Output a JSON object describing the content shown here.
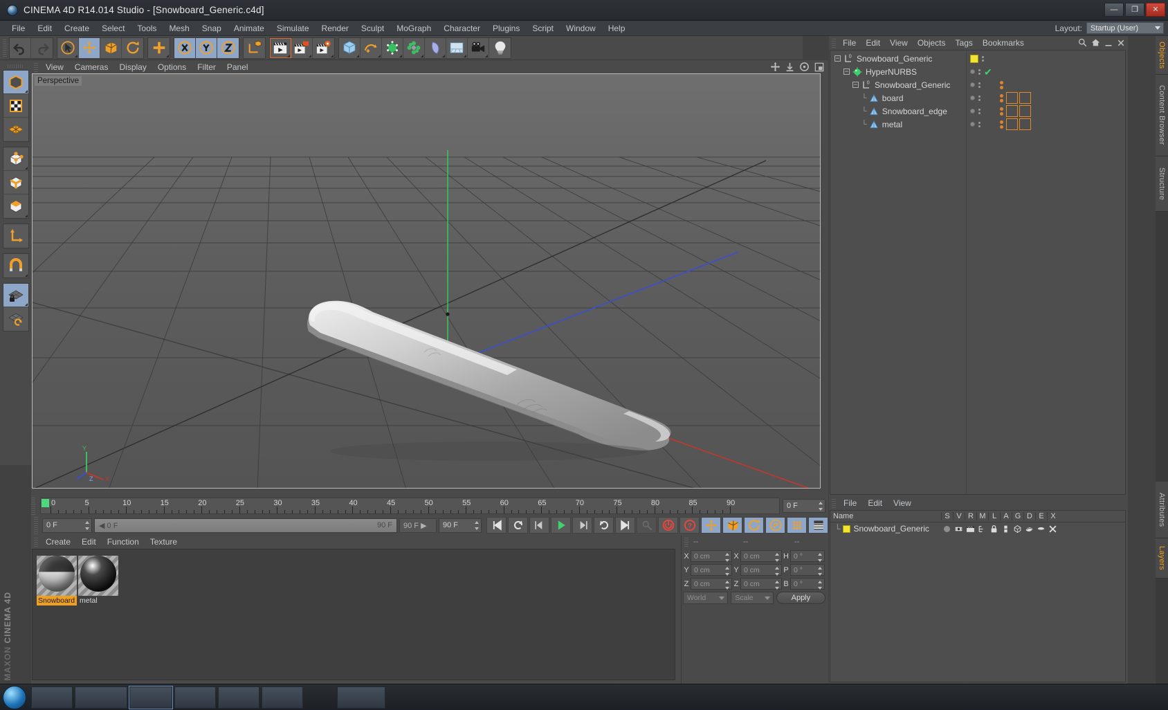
{
  "window": {
    "title": "CINEMA 4D R14.014 Studio - [Snowboard_Generic.c4d]",
    "logo_icon": "cinema4d-logo-icon",
    "buttons": {
      "minimize": "—",
      "maximize": "❐",
      "close": "✕"
    }
  },
  "menubar": {
    "items": [
      "File",
      "Edit",
      "Create",
      "Select",
      "Tools",
      "Mesh",
      "Snap",
      "Animate",
      "Simulate",
      "Render",
      "Sculpt",
      "MoGraph",
      "Character",
      "Plugins",
      "Script",
      "Window",
      "Help"
    ],
    "layout_label": "Layout:",
    "layout_value": "Startup (User)"
  },
  "toolbar": {
    "groups": [
      {
        "name": "history",
        "buttons": [
          {
            "name": "undo-button",
            "icon": "undo-icon",
            "state": "normal"
          },
          {
            "name": "redo-button",
            "icon": "redo-icon",
            "state": "disabled"
          }
        ]
      },
      {
        "name": "transform",
        "buttons": [
          {
            "name": "live-selection-tool",
            "icon": "cursor-circle-icon",
            "state": "normal"
          },
          {
            "name": "move-tool",
            "icon": "move-arrows-icon",
            "state": "active"
          },
          {
            "name": "scale-tool",
            "icon": "scale-box-icon",
            "state": "normal"
          },
          {
            "name": "rotate-tool",
            "icon": "rotate-arc-icon",
            "state": "normal"
          }
        ]
      },
      {
        "name": "place",
        "buttons": [
          {
            "name": "place-tool",
            "icon": "plus-cross-icon",
            "state": "normal"
          }
        ]
      },
      {
        "name": "axis-locks",
        "buttons": [
          {
            "name": "lock-x-axis",
            "icon": "x-axis-icon",
            "state": "active"
          },
          {
            "name": "lock-y-axis",
            "icon": "y-axis-icon",
            "state": "active"
          },
          {
            "name": "lock-z-axis",
            "icon": "z-axis-icon",
            "state": "active"
          }
        ]
      },
      {
        "name": "coord-system",
        "buttons": [
          {
            "name": "world-object-coordinates",
            "icon": "axis-cube-icon",
            "state": "normal"
          }
        ]
      },
      {
        "name": "render",
        "buttons": [
          {
            "name": "render-view-button",
            "icon": "clapperboard-icon",
            "state": "selected"
          },
          {
            "name": "render-region-button",
            "icon": "clapperboard-region-icon",
            "state": "normal"
          },
          {
            "name": "render-settings-button",
            "icon": "clapperboard-gear-icon",
            "state": "normal"
          }
        ]
      },
      {
        "name": "objects",
        "buttons": [
          {
            "name": "add-cube-object",
            "icon": "cube-icon",
            "state": "normal"
          },
          {
            "name": "add-spline",
            "icon": "spline-pen-icon",
            "state": "normal"
          },
          {
            "name": "add-nurbs-generator",
            "icon": "green-cube-icon",
            "state": "normal"
          },
          {
            "name": "add-array-object",
            "icon": "array-clover-icon",
            "state": "normal"
          },
          {
            "name": "add-deformer",
            "icon": "bend-deformer-icon",
            "state": "normal"
          },
          {
            "name": "add-environment",
            "icon": "floor-env-icon",
            "state": "normal"
          },
          {
            "name": "add-camera",
            "icon": "camera-icon",
            "state": "normal"
          },
          {
            "name": "add-light",
            "icon": "light-bulb-icon",
            "state": "normal"
          }
        ]
      }
    ]
  },
  "lefttoolbar": {
    "groups": [
      [
        {
          "name": "model-mode",
          "icon": "model-cube-icon",
          "state": "active"
        },
        {
          "name": "texture-mode",
          "icon": "texture-checker-icon",
          "state": "normal"
        },
        {
          "name": "deformation-mode",
          "icon": "deform-grid-icon",
          "state": "normal"
        }
      ],
      [
        {
          "name": "points-mode",
          "icon": "points-cube-icon",
          "state": "normal"
        },
        {
          "name": "edges-mode",
          "icon": "edges-cube-icon",
          "state": "normal"
        },
        {
          "name": "polygons-mode",
          "icon": "polygons-cube-icon",
          "state": "normal"
        }
      ],
      [
        {
          "name": "object-axis-mode",
          "icon": "axis-l-icon",
          "state": "normal"
        }
      ],
      [
        {
          "name": "enable-snapping",
          "icon": "magnet-icon",
          "state": "normal"
        }
      ],
      [
        {
          "name": "workplane-lock",
          "icon": "workplane-lock-icon",
          "state": "active"
        },
        {
          "name": "workplane-rotate",
          "icon": "workplane-rotate-icon",
          "state": "normal"
        }
      ]
    ]
  },
  "viewport": {
    "menu": [
      "View",
      "Cameras",
      "Display",
      "Options",
      "Filter",
      "Panel"
    ],
    "label": "Perspective",
    "nav_icons": [
      "pan-icon",
      "dolly-icon",
      "orbit-icon",
      "maximize-view-icon"
    ],
    "axes": {
      "x": "X",
      "y": "Y",
      "z": "Z"
    },
    "object": "snowboard-mesh"
  },
  "timeline": {
    "tick_labels": [
      "0",
      "5",
      "10",
      "15",
      "20",
      "25",
      "30",
      "35",
      "40",
      "45",
      "50",
      "55",
      "60",
      "65",
      "70",
      "75",
      "80",
      "85",
      "90"
    ],
    "min_frame": 0,
    "max_frame": 90,
    "current_frame_field": "0 F"
  },
  "playbar": {
    "start_field": "0 F",
    "scrub_left": "0 F",
    "scrub_right": "90 F",
    "end_preview": "90 F ▶",
    "end_field": "90 F",
    "buttons": [
      {
        "name": "go-to-start-button",
        "icon": "skip-start-icon",
        "state": "normal"
      },
      {
        "name": "play-backwards-loop-button",
        "icon": "loop-back-icon",
        "state": "normal"
      },
      {
        "name": "previous-frame-button",
        "icon": "step-back-icon",
        "state": "normal"
      },
      {
        "name": "play-button",
        "icon": "play-icon",
        "state": "normal"
      },
      {
        "name": "next-frame-button",
        "icon": "step-forward-icon",
        "state": "normal"
      },
      {
        "name": "play-forward-loop-button",
        "icon": "loop-forward-icon",
        "state": "normal"
      },
      {
        "name": "go-to-end-button",
        "icon": "skip-end-icon",
        "state": "normal"
      },
      {
        "name": "record-active-objects-button",
        "icon": "key-disabled-icon",
        "state": "disabled"
      },
      {
        "name": "autokeying-button",
        "icon": "autokey-icon",
        "state": "normal"
      },
      {
        "name": "keyframe-selection-button",
        "icon": "question-icon",
        "state": "normal"
      },
      {
        "name": "record-position-button",
        "icon": "position-move-icon",
        "state": "active"
      },
      {
        "name": "record-scale-button",
        "icon": "scale-icon",
        "state": "active"
      },
      {
        "name": "record-rotation-button",
        "icon": "rotation-icon",
        "state": "active"
      },
      {
        "name": "record-pla-button",
        "icon": "pla-icon",
        "state": "active"
      },
      {
        "name": "record-parameter-button",
        "icon": "param-dots-icon",
        "state": "active"
      },
      {
        "name": "level-of-detail-button",
        "icon": "lod-icon",
        "state": "active"
      }
    ]
  },
  "material_manager": {
    "menu": [
      "Create",
      "Edit",
      "Function",
      "Texture"
    ],
    "materials": [
      {
        "name": "Snowboard",
        "selected": true,
        "preview": "glossy-light-sphere"
      },
      {
        "name": "metal",
        "selected": false,
        "preview": "glossy-dark-sphere"
      }
    ]
  },
  "coordinates": {
    "headers": [
      "--",
      "--",
      "--"
    ],
    "rows": [
      {
        "l1": "X",
        "v1": "0 cm",
        "l2": "X",
        "v2": "0 cm",
        "l3": "H",
        "v3": "0 °"
      },
      {
        "l1": "Y",
        "v1": "0 cm",
        "l2": "Y",
        "v2": "0 cm",
        "l3": "P",
        "v3": "0 °"
      },
      {
        "l1": "Z",
        "v1": "0 cm",
        "l2": "Z",
        "v2": "0 cm",
        "l3": "B",
        "v3": "0 °"
      }
    ],
    "system_select": "World",
    "mode_select": "Scale",
    "apply_label": "Apply"
  },
  "object_manager": {
    "menu": [
      "File",
      "Edit",
      "View",
      "Objects",
      "Tags",
      "Bookmarks"
    ],
    "tools": [
      "search-icon",
      "home-icon",
      "minimize-icon",
      "close-icon"
    ],
    "items": [
      {
        "name": "Snowboard_Generic",
        "depth": 0,
        "icon": "null-object-icon",
        "expanded": true,
        "layer_color": "#f2e531",
        "tags": [],
        "check": false
      },
      {
        "name": "HyperNURBS",
        "depth": 1,
        "icon": "hypernurbs-icon",
        "expanded": true,
        "layer_color": "",
        "tags": [],
        "check": true
      },
      {
        "name": "Snowboard_Generic",
        "depth": 2,
        "icon": "null-object-icon",
        "expanded": true,
        "layer_color": "",
        "tags": [
          "dot"
        ],
        "check": false
      },
      {
        "name": "board",
        "depth": 3,
        "icon": "polygon-object-icon",
        "expanded": false,
        "layer_color": "",
        "tags": [
          "dot",
          "material-light",
          "checker"
        ],
        "check": false
      },
      {
        "name": "Snowboard_edge",
        "depth": 3,
        "icon": "polygon-object-icon",
        "expanded": false,
        "layer_color": "",
        "tags": [
          "dot",
          "material-light",
          "checker"
        ],
        "check": false
      },
      {
        "name": "metal",
        "depth": 3,
        "icon": "polygon-object-icon",
        "expanded": false,
        "layer_color": "",
        "tags": [
          "dot",
          "material-dark",
          "checker"
        ],
        "check": false
      }
    ]
  },
  "layer_manager": {
    "menu": [
      "File",
      "Edit",
      "View"
    ],
    "columns": [
      "Name",
      "S",
      "V",
      "R",
      "M",
      "L",
      "A",
      "G",
      "D",
      "E",
      "X"
    ],
    "rows": [
      {
        "name": "Snowboard_Generic",
        "color": "#f2e531",
        "cells": [
          "solo-dot",
          "view-icon",
          "render-icon",
          "manager-icon",
          "lock-icon",
          "animation-icon",
          "generator-icon",
          "deformer-icon",
          "expression-icon",
          "xref-icon"
        ]
      }
    ]
  },
  "side_tabs_top": [
    {
      "label": "Objects",
      "active": true
    },
    {
      "label": "Content Browser",
      "active": false
    },
    {
      "label": "Structure",
      "active": false
    }
  ],
  "side_tabs_bottom": [
    {
      "label": "Attributes",
      "active": false
    },
    {
      "label": "Layers",
      "active": true
    }
  ],
  "watermark": {
    "brand": "MAXON",
    "product": "CINEMA 4D"
  },
  "colors": {
    "accent_orange": "#e0832a",
    "active_blue": "#8ea7c9",
    "layer_yellow": "#f2e531",
    "play_green": "#4fd97f",
    "axis_x": "#c0392b",
    "axis_y": "#3fbf5f",
    "axis_z": "#3b4fd0"
  }
}
